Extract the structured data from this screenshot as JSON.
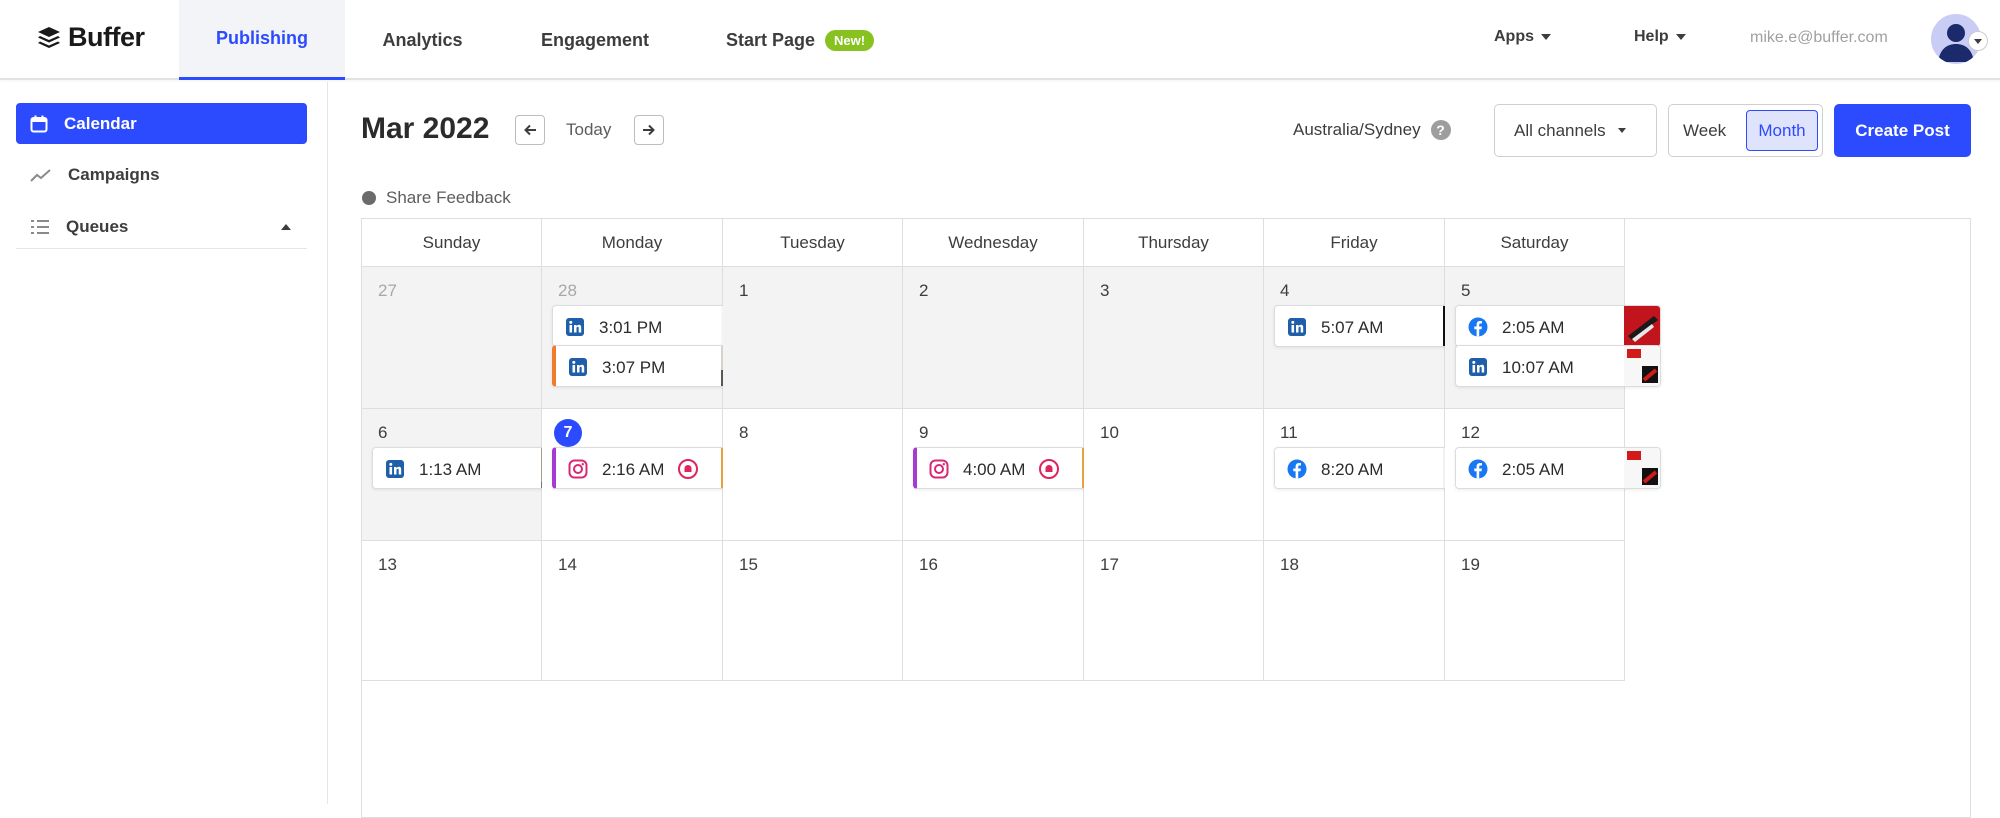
{
  "brand": {
    "name": "Buffer"
  },
  "nav": {
    "tabs": [
      {
        "label": "Publishing",
        "active": true
      },
      {
        "label": "Analytics",
        "active": false
      },
      {
        "label": "Engagement",
        "active": false
      },
      {
        "label": "Start Page",
        "active": false,
        "badge": "New!"
      }
    ],
    "apps_label": "Apps",
    "help_label": "Help",
    "user_email": "mike.e@buffer.com"
  },
  "sidebar": {
    "items": [
      {
        "label": "Calendar",
        "icon": "calendar-icon",
        "active": true
      },
      {
        "label": "Campaigns",
        "icon": "trend-icon",
        "active": false
      },
      {
        "label": "Queues",
        "icon": "list-icon",
        "active": false
      }
    ]
  },
  "header": {
    "month": "Mar 2022",
    "today_label": "Today",
    "timezone": "Australia/Sydney",
    "channels_label": "All channels",
    "view_week": "Week",
    "view_month": "Month",
    "create_label": "Create Post",
    "feedback_label": "Share Feedback"
  },
  "calendar": {
    "weekdays": [
      "Sunday",
      "Monday",
      "Tuesday",
      "Wednesday",
      "Thursday",
      "Friday",
      "Saturday"
    ],
    "weeks": [
      [
        {
          "day": "27",
          "muted": true,
          "past": true,
          "posts": []
        },
        {
          "day": "28",
          "muted": true,
          "past": true,
          "posts": [
            {
              "network": "linkedin",
              "time": "3:01 PM",
              "thumb": "shoes",
              "bar": ""
            },
            {
              "network": "linkedin",
              "time": "3:07 PM",
              "thumb": "office",
              "bar": "orange"
            }
          ]
        },
        {
          "day": "1",
          "past": true,
          "posts": []
        },
        {
          "day": "2",
          "past": true,
          "posts": []
        },
        {
          "day": "3",
          "past": true,
          "posts": []
        },
        {
          "day": "4",
          "past": true,
          "posts": [
            {
              "network": "linkedin",
              "time": "5:07 AM",
              "thumb": "dark",
              "bar": ""
            }
          ]
        },
        {
          "day": "5",
          "past": true,
          "posts": [
            {
              "network": "facebook",
              "time": "2:05 AM",
              "thumb": "red",
              "bar": ""
            },
            {
              "network": "linkedin",
              "time": "10:07 AM",
              "thumb": "poster",
              "bar": ""
            }
          ]
        }
      ],
      [
        {
          "day": "6",
          "past": true,
          "posts": [
            {
              "network": "linkedin",
              "time": "1:13 AM",
              "thumb": "cat",
              "bar": ""
            }
          ]
        },
        {
          "day": "7",
          "today": true,
          "posts": [
            {
              "network": "instagram",
              "time": "2:16 AM",
              "thumb": "orange",
              "bar": "purple",
              "bell": true
            }
          ]
        },
        {
          "day": "8",
          "posts": []
        },
        {
          "day": "9",
          "posts": [
            {
              "network": "instagram",
              "time": "4:00 AM",
              "thumb": "orange",
              "bar": "purple",
              "bell": true
            }
          ]
        },
        {
          "day": "10",
          "posts": []
        },
        {
          "day": "11",
          "posts": [
            {
              "network": "facebook",
              "time": "8:20 AM",
              "thumb": "light",
              "bar": ""
            }
          ]
        },
        {
          "day": "12",
          "posts": [
            {
              "network": "facebook",
              "time": "2:05 AM",
              "thumb": "poster",
              "bar": ""
            }
          ]
        }
      ],
      [
        {
          "day": "13",
          "posts": []
        },
        {
          "day": "14",
          "posts": []
        },
        {
          "day": "15",
          "posts": []
        },
        {
          "day": "16",
          "posts": []
        },
        {
          "day": "17",
          "posts": []
        },
        {
          "day": "18",
          "posts": []
        },
        {
          "day": "19",
          "posts": []
        }
      ]
    ]
  },
  "colors": {
    "accent": "#2c4bff",
    "new_badge": "#87c221",
    "linkedin": "#1f5ea8",
    "facebook": "#1877f2",
    "instagram": "#d62976",
    "bar_orange": "#f07b2a",
    "bar_purple": "#a53bd3"
  }
}
